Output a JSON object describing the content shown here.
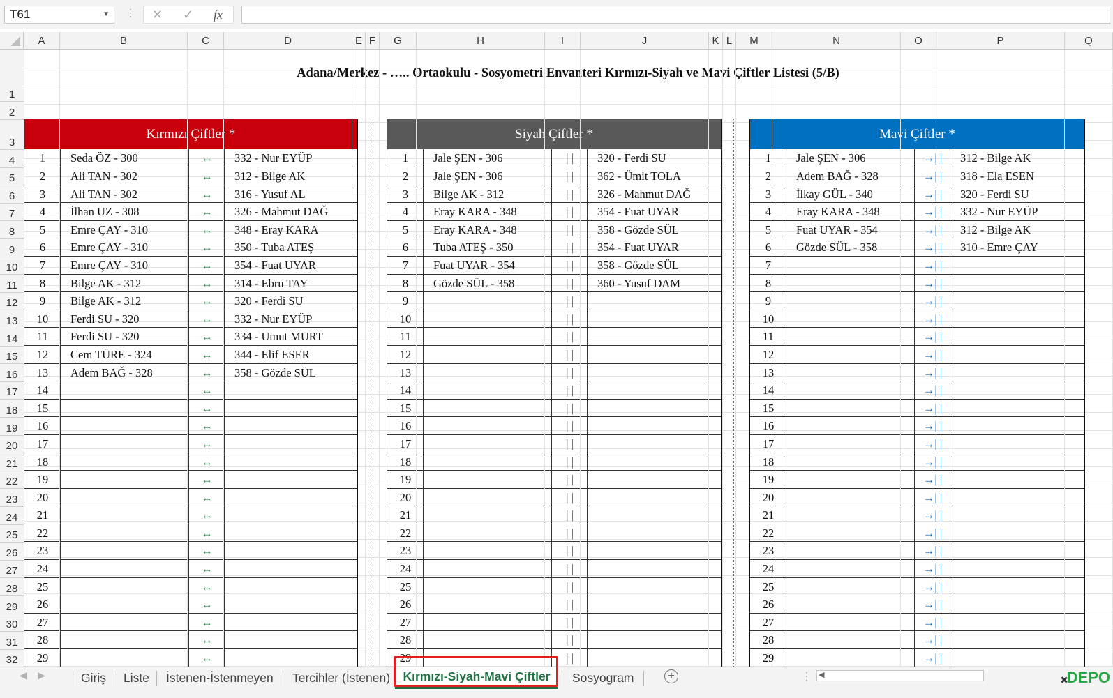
{
  "name_box": "T61",
  "formula_icons": {
    "cancel": "✕",
    "enter": "✓",
    "fx": "fx"
  },
  "columns": [
    "A",
    "B",
    "C",
    "D",
    "E",
    "F",
    "G",
    "H",
    "I",
    "J",
    "K",
    "L",
    "M",
    "N",
    "O",
    "P",
    "Q"
  ],
  "rows": [
    "1",
    "2",
    "3",
    "4",
    "5",
    "6",
    "7",
    "8",
    "9",
    "10",
    "11",
    "12",
    "13",
    "14",
    "15",
    "16",
    "17",
    "18",
    "19",
    "20",
    "21",
    "22",
    "23",
    "24",
    "25",
    "26",
    "27",
    "28",
    "29",
    "30",
    "31",
    "32"
  ],
  "title": "Adana/Merkez - ….. Ortaokulu - Sosyometri Envanteri Kırmızı-Siyah ve Mavi Çiftler Listesi (5/B)",
  "red": {
    "header": "Kırmızı Çiftler *",
    "symbol": "↔",
    "color": "#c9000b",
    "rows": [
      [
        "1",
        "Seda ÖZ - 300",
        "332 - Nur EYÜP"
      ],
      [
        "2",
        "Ali TAN - 302",
        "312 - Bilge AK"
      ],
      [
        "3",
        "Ali TAN - 302",
        "316 - Yusuf AL"
      ],
      [
        "4",
        "İlhan UZ - 308",
        "326 - Mahmut DAĞ"
      ],
      [
        "5",
        "Emre ÇAY - 310",
        "348 - Eray KARA"
      ],
      [
        "6",
        "Emre ÇAY - 310",
        "350 - Tuba ATEŞ"
      ],
      [
        "7",
        "Emre ÇAY - 310",
        "354 - Fuat UYAR"
      ],
      [
        "8",
        "Bilge AK - 312",
        "314 - Ebru TAY"
      ],
      [
        "9",
        "Bilge AK - 312",
        "320 - Ferdi SU"
      ],
      [
        "10",
        "Ferdi SU - 320",
        "332 - Nur EYÜP"
      ],
      [
        "11",
        "Ferdi SU - 320",
        "334 - Umut MURT"
      ],
      [
        "12",
        "Cem TÜRE - 324",
        "344 - Elif ESER"
      ],
      [
        "13",
        "Adem BAĞ - 328",
        "358 - Gözde SÜL"
      ],
      [
        "14",
        "",
        ""
      ],
      [
        "15",
        "",
        ""
      ],
      [
        "16",
        "",
        ""
      ],
      [
        "17",
        "",
        ""
      ],
      [
        "18",
        "",
        ""
      ],
      [
        "19",
        "",
        ""
      ],
      [
        "20",
        "",
        ""
      ],
      [
        "21",
        "",
        ""
      ],
      [
        "22",
        "",
        ""
      ],
      [
        "23",
        "",
        ""
      ],
      [
        "24",
        "",
        ""
      ],
      [
        "25",
        "",
        ""
      ],
      [
        "26",
        "",
        ""
      ],
      [
        "27",
        "",
        ""
      ],
      [
        "28",
        "",
        ""
      ],
      [
        "29",
        "",
        ""
      ]
    ]
  },
  "black": {
    "header": "Siyah Çiftler *",
    "symbol": "| |",
    "color": "#595959",
    "rows": [
      [
        "1",
        "Jale ŞEN - 306",
        "320 - Ferdi SU"
      ],
      [
        "2",
        "Jale ŞEN - 306",
        "362 - Ümit TOLA"
      ],
      [
        "3",
        "Bilge AK - 312",
        "326 - Mahmut DAĞ"
      ],
      [
        "4",
        "Eray KARA - 348",
        "354 - Fuat UYAR"
      ],
      [
        "5",
        "Eray KARA - 348",
        "358 - Gözde SÜL"
      ],
      [
        "6",
        "Tuba ATEŞ - 350",
        "354 - Fuat UYAR"
      ],
      [
        "7",
        "Fuat UYAR - 354",
        "358 - Gözde SÜL"
      ],
      [
        "8",
        "Gözde SÜL - 358",
        "360 - Yusuf DAM"
      ],
      [
        "9",
        "",
        ""
      ],
      [
        "10",
        "",
        ""
      ],
      [
        "11",
        "",
        ""
      ],
      [
        "12",
        "",
        ""
      ],
      [
        "13",
        "",
        ""
      ],
      [
        "14",
        "",
        ""
      ],
      [
        "15",
        "",
        ""
      ],
      [
        "16",
        "",
        ""
      ],
      [
        "17",
        "",
        ""
      ],
      [
        "18",
        "",
        ""
      ],
      [
        "19",
        "",
        ""
      ],
      [
        "20",
        "",
        ""
      ],
      [
        "21",
        "",
        ""
      ],
      [
        "22",
        "",
        ""
      ],
      [
        "23",
        "",
        ""
      ],
      [
        "24",
        "",
        ""
      ],
      [
        "25",
        "",
        ""
      ],
      [
        "26",
        "",
        ""
      ],
      [
        "27",
        "",
        ""
      ],
      [
        "28",
        "",
        ""
      ],
      [
        "29",
        "",
        ""
      ]
    ]
  },
  "blue": {
    "header": "Mavi Çiftler *",
    "symbol": "→| |",
    "color": "#0070c0",
    "rows": [
      [
        "1",
        "Jale ŞEN - 306",
        "312 - Bilge AK"
      ],
      [
        "2",
        "Adem BAĞ - 328",
        "318 - Ela ESEN"
      ],
      [
        "3",
        "İlkay GÜL - 340",
        "320 - Ferdi SU"
      ],
      [
        "4",
        "Eray KARA - 348",
        "332 - Nur EYÜP"
      ],
      [
        "5",
        "Fuat UYAR - 354",
        "312 - Bilge AK"
      ],
      [
        "6",
        "Gözde SÜL - 358",
        "310 - Emre ÇAY"
      ],
      [
        "7",
        "",
        ""
      ],
      [
        "8",
        "",
        ""
      ],
      [
        "9",
        "",
        ""
      ],
      [
        "10",
        "",
        ""
      ],
      [
        "11",
        "",
        ""
      ],
      [
        "12",
        "",
        ""
      ],
      [
        "13",
        "",
        ""
      ],
      [
        "14",
        "",
        ""
      ],
      [
        "15",
        "",
        ""
      ],
      [
        "16",
        "",
        ""
      ],
      [
        "17",
        "",
        ""
      ],
      [
        "18",
        "",
        ""
      ],
      [
        "19",
        "",
        ""
      ],
      [
        "20",
        "",
        ""
      ],
      [
        "21",
        "",
        ""
      ],
      [
        "22",
        "",
        ""
      ],
      [
        "23",
        "",
        ""
      ],
      [
        "24",
        "",
        ""
      ],
      [
        "25",
        "",
        ""
      ],
      [
        "26",
        "",
        ""
      ],
      [
        "27",
        "",
        ""
      ],
      [
        "28",
        "",
        ""
      ],
      [
        "29",
        "",
        ""
      ]
    ]
  },
  "tabs": [
    "Giriş",
    "Liste",
    "İstenen-İstenmeyen",
    "Tercihler (İstenen)",
    "Kırmızı-Siyah-Mavi Çiftler",
    "Sosyogram"
  ],
  "active_tab": "Kırmızı-Siyah-Mavi Çiftler",
  "add_sheet": "+",
  "logo": "DEPO"
}
